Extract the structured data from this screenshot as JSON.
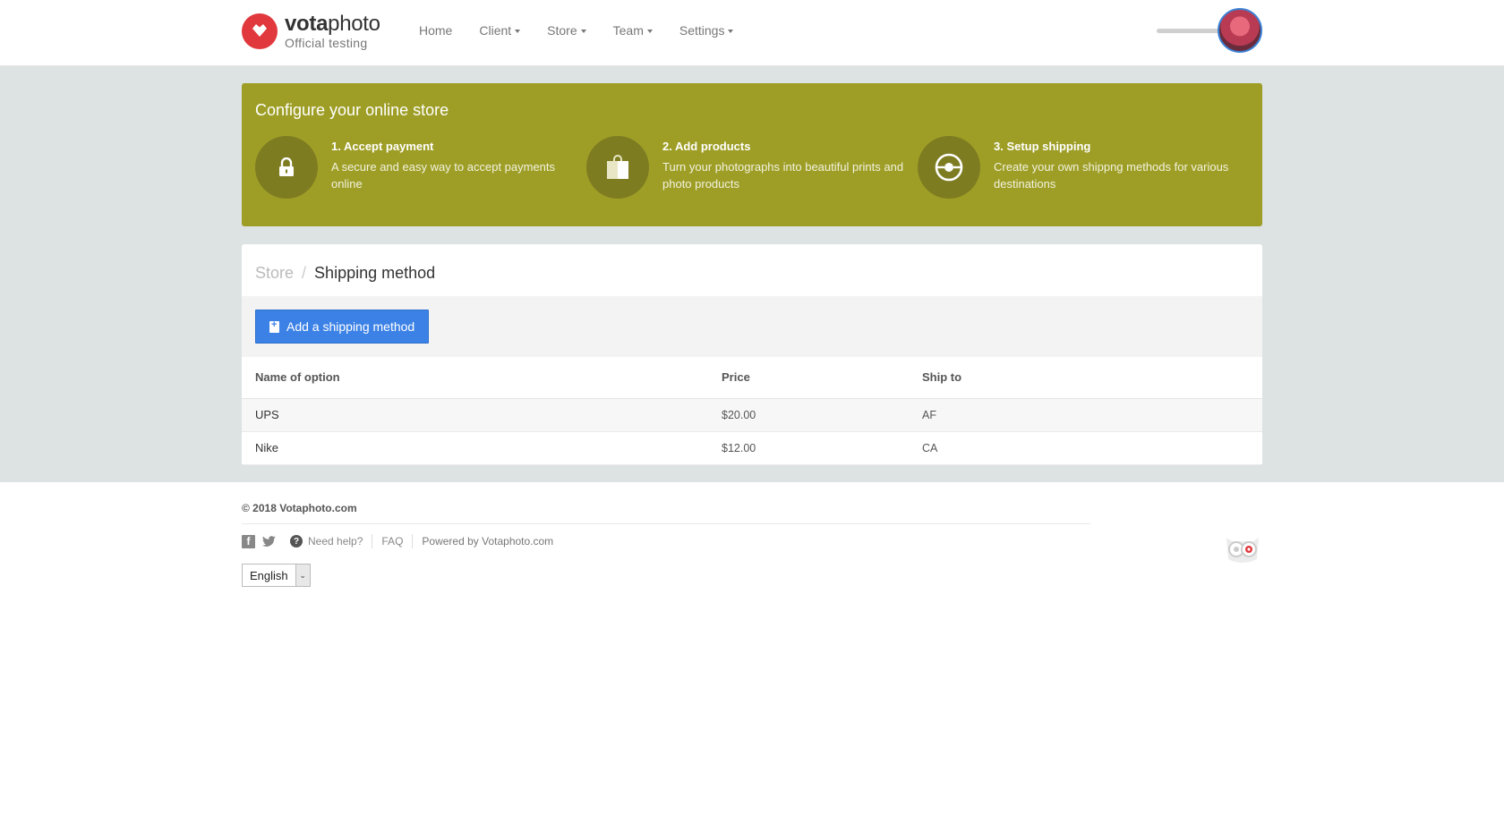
{
  "brand": {
    "name_bold": "vota",
    "name_light": "photo",
    "subtitle": "Official testing"
  },
  "nav": {
    "items": [
      {
        "label": "Home"
      },
      {
        "label": "Client"
      },
      {
        "label": "Store"
      },
      {
        "label": "Team"
      },
      {
        "label": "Settings"
      }
    ]
  },
  "banner": {
    "title": "Configure your online store",
    "steps": [
      {
        "title": "1. Accept payment",
        "desc": "A secure and easy way to accept payments online",
        "icon": "lock-icon"
      },
      {
        "title": "2. Add products",
        "desc": "Turn your photographs into beautiful prints and photo products",
        "icon": "shopping-bag-icon"
      },
      {
        "title": "3. Setup shipping",
        "desc": "Create your own shippng methods for various destinations",
        "icon": "target-icon"
      }
    ],
    "color": "#9e9e27"
  },
  "breadcrumb": {
    "parent": "Store",
    "separator": "/",
    "current": "Shipping method"
  },
  "toolbar": {
    "add_label": "Add a shipping method",
    "accent": "#3c82e6"
  },
  "table": {
    "headers": [
      "Name of option",
      "Price",
      "Ship to"
    ],
    "rows": [
      {
        "name": "UPS",
        "price": "$20.00",
        "ship_to": "AF"
      },
      {
        "name": "Nike",
        "price": "$12.00",
        "ship_to": "CA"
      }
    ]
  },
  "footer": {
    "copyright": "© 2018 Votaphoto.com",
    "need_help": "Need help?",
    "faq": "FAQ",
    "powered_prefix": "Powered by",
    "powered_link": "Votaphoto.com",
    "language": "English"
  }
}
